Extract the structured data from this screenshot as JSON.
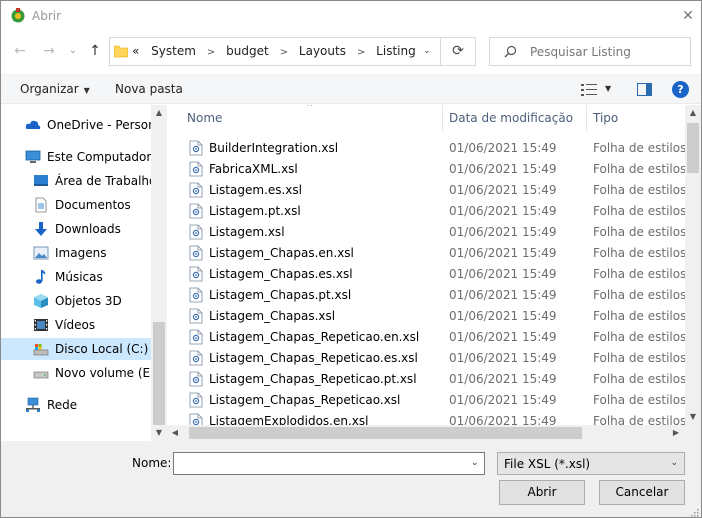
{
  "window": {
    "title": "Abrir"
  },
  "nav": {
    "back": "←",
    "forward": "→",
    "recent": "⌄",
    "up": "↑",
    "refresh": "⟳"
  },
  "address": {
    "overflow": "«",
    "crumbs": [
      "System",
      "budget",
      "Layouts",
      "Listing"
    ],
    "dropdown": "⌄"
  },
  "search": {
    "placeholder": "Pesquisar Listing"
  },
  "toolbar": {
    "organize_label": "Organizar",
    "new_folder_label": "Nova pasta",
    "help_label": "?"
  },
  "sidebar": {
    "items": [
      {
        "label": "OneDrive - Persona",
        "icon": "cloud-icon"
      },
      {
        "label": "Este Computador",
        "icon": "computer-icon"
      },
      {
        "label": "Área de Trabalho",
        "icon": "desktop-icon"
      },
      {
        "label": "Documentos",
        "icon": "documents-icon"
      },
      {
        "label": "Downloads",
        "icon": "downloads-icon"
      },
      {
        "label": "Imagens",
        "icon": "pictures-icon"
      },
      {
        "label": "Músicas",
        "icon": "music-icon"
      },
      {
        "label": "Objetos 3D",
        "icon": "objects-3d-icon"
      },
      {
        "label": "Vídeos",
        "icon": "videos-icon"
      },
      {
        "label": "Disco Local (C:)",
        "icon": "local-disk-icon",
        "selected": true
      },
      {
        "label": "Novo volume (E:)",
        "icon": "drive-icon"
      },
      {
        "label": "Rede",
        "icon": "network-icon"
      }
    ]
  },
  "columns": {
    "name": "Nome",
    "date": "Data de modificação",
    "type": "Tipo"
  },
  "files": [
    {
      "name": "BuilderIntegration.xsl",
      "date": "01/06/2021 15:49",
      "type": "Folha de estilos XSL"
    },
    {
      "name": "FabricaXML.xsl",
      "date": "01/06/2021 15:49",
      "type": "Folha de estilos XSL"
    },
    {
      "name": "Listagem.es.xsl",
      "date": "01/06/2021 15:49",
      "type": "Folha de estilos XSL"
    },
    {
      "name": "Listagem.pt.xsl",
      "date": "01/06/2021 15:49",
      "type": "Folha de estilos XSL"
    },
    {
      "name": "Listagem.xsl",
      "date": "01/06/2021 15:49",
      "type": "Folha de estilos XSL"
    },
    {
      "name": "Listagem_Chapas.en.xsl",
      "date": "01/06/2021 15:49",
      "type": "Folha de estilos XSL"
    },
    {
      "name": "Listagem_Chapas.es.xsl",
      "date": "01/06/2021 15:49",
      "type": "Folha de estilos XSL"
    },
    {
      "name": "Listagem_Chapas.pt.xsl",
      "date": "01/06/2021 15:49",
      "type": "Folha de estilos XSL"
    },
    {
      "name": "Listagem_Chapas.xsl",
      "date": "01/06/2021 15:49",
      "type": "Folha de estilos XSL"
    },
    {
      "name": "Listagem_Chapas_Repeticao.en.xsl",
      "date": "01/06/2021 15:49",
      "type": "Folha de estilos XSL"
    },
    {
      "name": "Listagem_Chapas_Repeticao.es.xsl",
      "date": "01/06/2021 15:49",
      "type": "Folha de estilos XSL"
    },
    {
      "name": "Listagem_Chapas_Repeticao.pt.xsl",
      "date": "01/06/2021 15:49",
      "type": "Folha de estilos XSL"
    },
    {
      "name": "Listagem_Chapas_Repeticao.xsl",
      "date": "01/06/2021 15:49",
      "type": "Folha de estilos XSL"
    },
    {
      "name": "ListagemExplodidos.en.xsl",
      "date": "01/06/2021 15:49",
      "type": "Folha de estilos XSL"
    }
  ],
  "footer": {
    "name_label": "Nome:",
    "name_value": "",
    "filter_value": "File XSL (*.xsl)",
    "open_label": "Abrir",
    "cancel_label": "Cancelar"
  },
  "colors": {
    "selection": "#cce8ff",
    "accent": "#1a64c8",
    "header_text": "#4c607a"
  }
}
